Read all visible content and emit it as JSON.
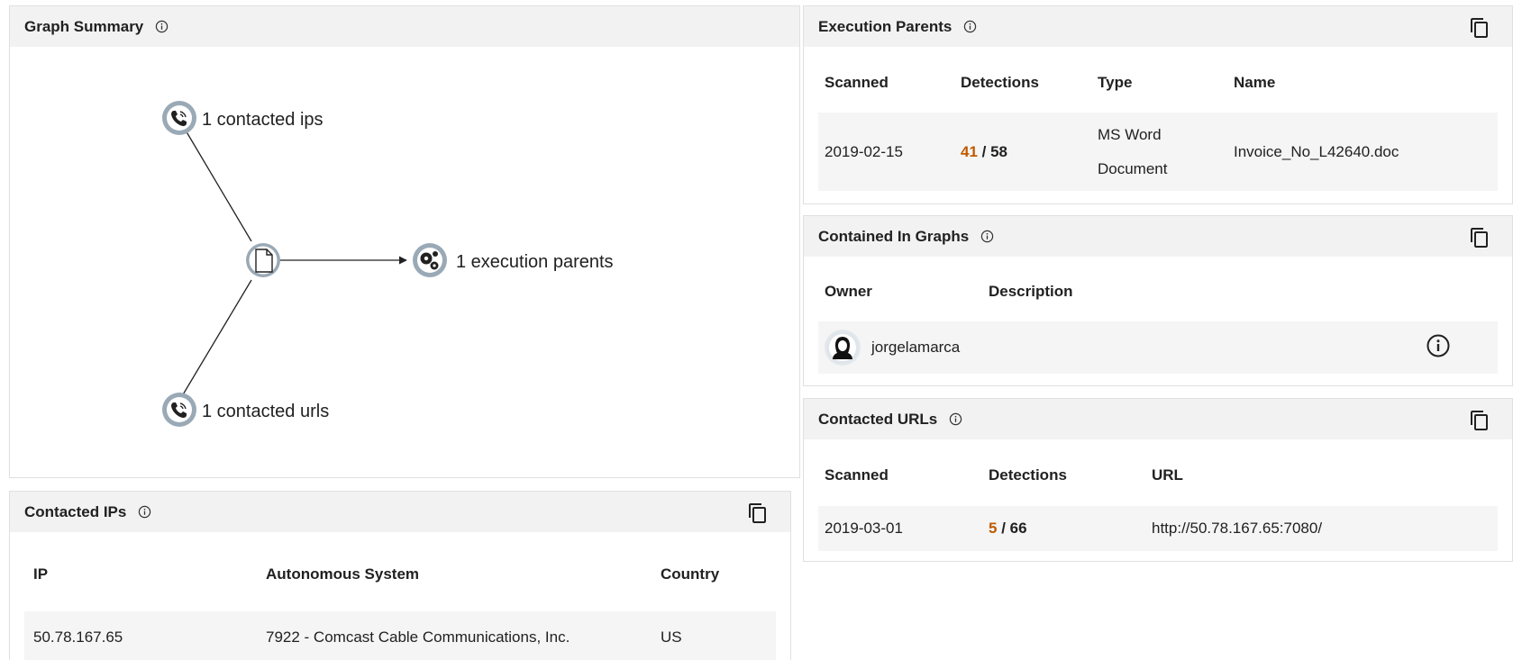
{
  "graph_summary": {
    "title": "Graph Summary",
    "nodes": {
      "ips": "1 contacted ips",
      "parents": "1 execution parents",
      "urls": "1 contacted urls"
    }
  },
  "contacted_ips": {
    "title": "Contacted IPs",
    "columns": [
      "IP",
      "Autonomous System",
      "Country"
    ],
    "rows": [
      {
        "ip": "50.78.167.65",
        "as": "7922 - Comcast Cable Communications, Inc.",
        "country": "US"
      }
    ]
  },
  "execution_parents": {
    "title": "Execution Parents",
    "columns": [
      "Scanned",
      "Detections",
      "Type",
      "Name"
    ],
    "rows": [
      {
        "scanned": "2019-02-15",
        "detections_pos": "41",
        "detections_sep": " / ",
        "detections_total": "58",
        "type_line1": "MS Word",
        "type_line2": "Document",
        "name": "Invoice_No_L42640.doc"
      }
    ]
  },
  "contained_in_graphs": {
    "title": "Contained In Graphs",
    "columns": [
      "Owner",
      "Description"
    ],
    "rows": [
      {
        "owner": "jorgelamarca",
        "description": ""
      }
    ]
  },
  "contacted_urls": {
    "title": "Contacted URLs",
    "columns": [
      "Scanned",
      "Detections",
      "URL"
    ],
    "rows": [
      {
        "scanned": "2019-03-01",
        "detections_pos": "5",
        "detections_sep": " / ",
        "detections_total": "66",
        "url": "http://50.78.167.65:7080/"
      }
    ]
  },
  "colors": {
    "detection_positive": "#bf5a00",
    "header_bg": "#f2f2f2",
    "row_bg": "#f5f5f5",
    "node_ring": "#9aa9b6"
  },
  "icons": {
    "info": "info-icon",
    "copy": "copy-icon",
    "file": "file-icon",
    "phone": "phone-icon",
    "gears": "gears-icon",
    "avatar": "avatar-icon"
  }
}
